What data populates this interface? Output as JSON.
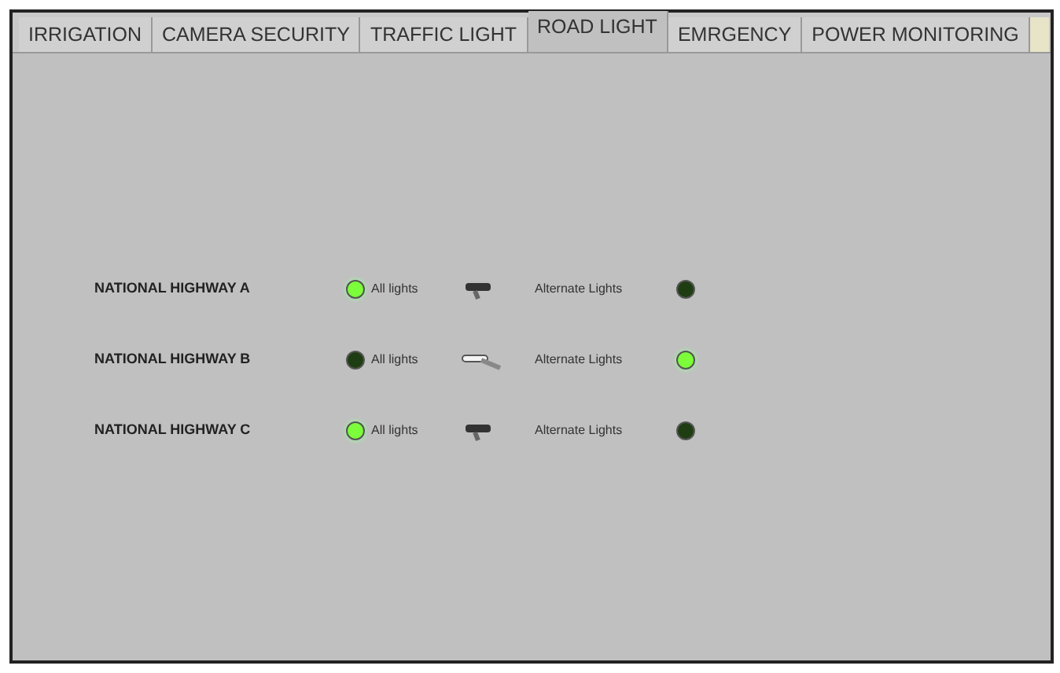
{
  "tabs": [
    {
      "label": "IRRIGATION",
      "selected": false
    },
    {
      "label": "CAMERA SECURITY",
      "selected": false
    },
    {
      "label": "TRAFFIC LIGHT",
      "selected": false
    },
    {
      "label": "ROAD LIGHT",
      "selected": true
    },
    {
      "label": "EMRGENCY",
      "selected": false
    },
    {
      "label": "POWER MONITORING",
      "selected": false
    }
  ],
  "highways": [
    {
      "name": "NATIONAL HIGHWAY A",
      "all_label": "All lights",
      "alternate_label": "Alternate Lights",
      "alternate": false
    },
    {
      "name": "NATIONAL HIGHWAY B",
      "all_label": "All lights",
      "alternate_label": "Alternate Lights",
      "alternate": true
    },
    {
      "name": "NATIONAL HIGHWAY C",
      "all_label": "All lights",
      "alternate_label": "Alternate Lights",
      "alternate": false
    }
  ]
}
